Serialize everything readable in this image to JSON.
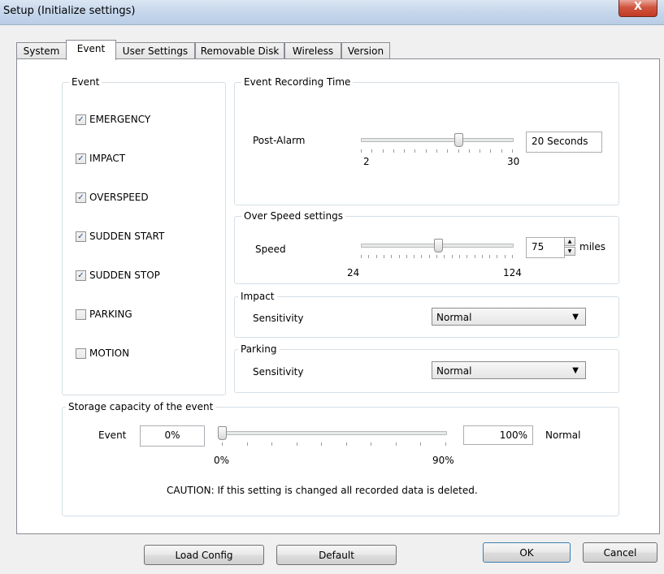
{
  "window": {
    "title": "Setup (Initialize settings)",
    "close_glyph": "X"
  },
  "tabs": [
    {
      "label": "System"
    },
    {
      "label": "Event"
    },
    {
      "label": "User Settings"
    },
    {
      "label": "Removable Disk"
    },
    {
      "label": "Wireless"
    },
    {
      "label": "Version"
    }
  ],
  "active_tab": "Event",
  "event_group": {
    "legend": "Event",
    "items": [
      {
        "label": "EMERGENCY",
        "checked": true
      },
      {
        "label": "IMPACT",
        "checked": true
      },
      {
        "label": "OVERSPEED",
        "checked": true
      },
      {
        "label": "SUDDEN START",
        "checked": true
      },
      {
        "label": "SUDDEN STOP",
        "checked": true
      },
      {
        "label": "PARKING",
        "checked": false
      },
      {
        "label": "MOTION",
        "checked": false
      }
    ]
  },
  "recording_time": {
    "legend": "Event Recording Time",
    "label": "Post-Alarm",
    "min_label": "2",
    "max_label": "30",
    "value_text": "20 Seconds",
    "value": 20,
    "min": 2,
    "max": 30
  },
  "over_speed": {
    "legend": "Over Speed settings",
    "label": "Speed",
    "min_label": "24",
    "max_label": "124",
    "value_text": "75",
    "unit": "miles",
    "value": 75,
    "min": 24,
    "max": 124
  },
  "impact": {
    "legend": "Impact",
    "label": "Sensitivity",
    "selected": "Normal"
  },
  "parking": {
    "legend": "Parking",
    "label": "Sensitivity",
    "selected": "Normal"
  },
  "storage": {
    "legend": "Storage capacity of the event",
    "event_label": "Event",
    "event_value": "0%",
    "min_label": "0%",
    "max_label": "90%",
    "normal_value": "100%",
    "normal_label": "Normal",
    "value": 0,
    "min": 0,
    "max": 90,
    "caution": "CAUTION: If this setting is changed all recorded data is deleted."
  },
  "buttons": {
    "load_config": "Load Config",
    "default": "Default",
    "ok": "OK",
    "cancel": "Cancel"
  }
}
